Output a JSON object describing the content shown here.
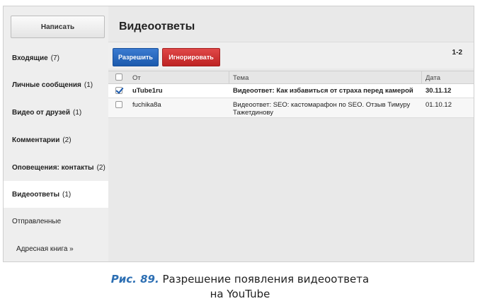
{
  "sidebar": {
    "compose_label": "Написать",
    "items": [
      {
        "label": "Входящие",
        "count": "(7)"
      },
      {
        "label": "Личные сообщения",
        "count": "(1)"
      },
      {
        "label": "Видео от друзей",
        "count": "(1)"
      },
      {
        "label": "Комментарии",
        "count": "(2)"
      },
      {
        "label": "Оповещения: контакты",
        "count": "(2)"
      },
      {
        "label": "Видеоответы",
        "count": "(1)"
      },
      {
        "label": "Отправленные",
        "count": ""
      }
    ],
    "address_book": "Адресная книга »"
  },
  "main": {
    "title": "Видеоответы",
    "toolbar": {
      "allow_label": "Разрешить",
      "ignore_label": "Игнорировать",
      "pager": "1-2"
    },
    "table": {
      "headers": {
        "from": "От",
        "subject": "Тема",
        "date": "Дата"
      },
      "rows": [
        {
          "checked": true,
          "from": "uTube1ru",
          "subject": "Видеоответ: Как избавиться от страха перед камерой",
          "date": "30.11.12"
        },
        {
          "checked": false,
          "from": "fuchika8a",
          "subject": "Видеоответ: SEO: кастомарафон по SEO. Отзыв Тимуру Тажетдинову",
          "date": "01.10.12"
        }
      ]
    }
  },
  "caption": {
    "figure": "Рис. 89.",
    "line1": "Разрешение появления видеоответа",
    "line2": "на YouTube"
  },
  "colors": {
    "allow": "#1c5aad",
    "ignore": "#be2323",
    "caption_accent": "#2d6fb3"
  }
}
